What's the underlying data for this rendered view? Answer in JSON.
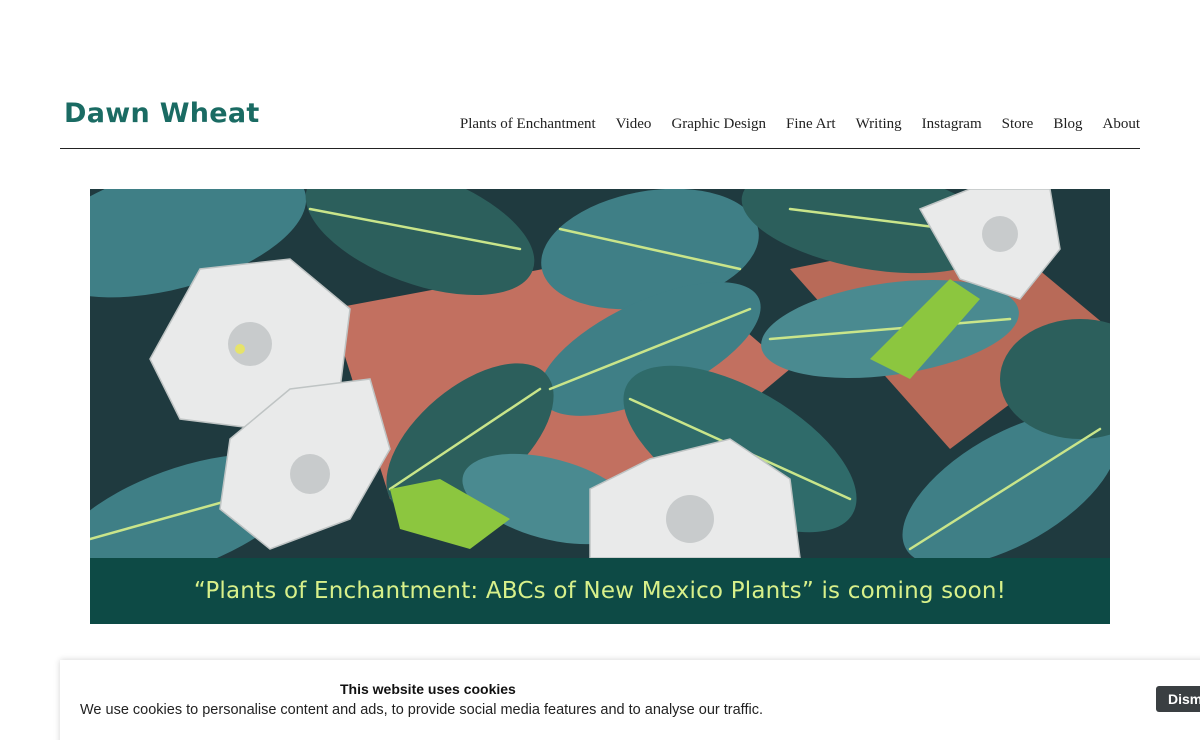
{
  "header": {
    "logo": "Dawn Wheat",
    "nav": [
      {
        "label": "Plants of Enchantment"
      },
      {
        "label": "Video"
      },
      {
        "label": "Graphic Design"
      },
      {
        "label": "Fine Art"
      },
      {
        "label": "Writing"
      },
      {
        "label": "Instagram"
      },
      {
        "label": "Store"
      },
      {
        "label": "Blog"
      },
      {
        "label": "About"
      }
    ]
  },
  "hero": {
    "caption": "“Plants of Enchantment: ABCs of New Mexico Plants” is coming soon!",
    "colors": {
      "background": "#1f3a3f",
      "leaf": "#3f7f86",
      "leaf_dark": "#2c5f5c",
      "vein": "#c9e58a",
      "flower": "#e9eaea",
      "accent": "#c27060",
      "banner": "#0d4a45",
      "caption": "#d8f08a"
    }
  },
  "cookie": {
    "title": "This website uses cookies",
    "text": "We use cookies to personalise content and ads, to provide social media features and to analyse our traffic.",
    "dismiss_label": "Dism"
  },
  "theme": {
    "brand": "#1a6b63"
  }
}
